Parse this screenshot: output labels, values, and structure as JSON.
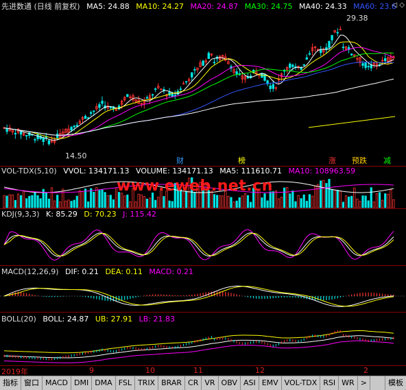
{
  "main": {
    "title": "先进数通 (日线 前复权)",
    "ma5": "MA5: 24.88",
    "ma10": "MA10: 24.27",
    "ma20": "MA20: 24.87",
    "ma30": "MA30: 24.75",
    "ma40": "MA40: 24.33",
    "ma60": "MA60: 23.6",
    "high_label": "29.38",
    "low_label": "14.50",
    "markers": [
      "财",
      "榜",
      "涨",
      "预跌",
      "减"
    ],
    "colors": {
      "up": "#ff3333",
      "down": "#00e5e5",
      "ma5": "#ffffff",
      "ma10": "#ffff00",
      "ma20": "#ff00ff",
      "ma30": "#00ff00",
      "ma40": "#ffffff",
      "ma60": "#3355ff"
    }
  },
  "vol": {
    "name": "VOL-TDX(5,10)",
    "vvol": "VVOL: 134171.13",
    "volume": "VOLUME: 134171.13",
    "ma5": "MA5: 111610.71",
    "ma10": "MA10: 108963.59"
  },
  "watermark": "www.eweb.net.cn",
  "kdj": {
    "name": "KDJ(9,3,3)",
    "k": "K: 85.29",
    "d": "D: 70.23",
    "j": "J: 115.42"
  },
  "macd": {
    "name": "MACD(12,26,9)",
    "dif": "DIF: 0.21",
    "dea": "DEA: 0.11",
    "macd": "MACD: 0.21"
  },
  "boll": {
    "name": "BOLL(20)",
    "boll": "BOLL: 24.87",
    "ub": "UB: 27.91",
    "lb": "LB: 21.83"
  },
  "xaxis": [
    "2019年",
    "9",
    "10",
    "11",
    "12",
    "2"
  ],
  "tabs": [
    "指标",
    "窗口",
    "MACD",
    "DMI",
    "DMA",
    "FSL",
    "TRIX",
    "BRAR",
    "CR",
    "VR",
    "OBV",
    "ASI",
    "EMV",
    "VOL-TDX",
    "RSI",
    "WR",
    ">"
  ],
  "tab_right": "模板"
}
